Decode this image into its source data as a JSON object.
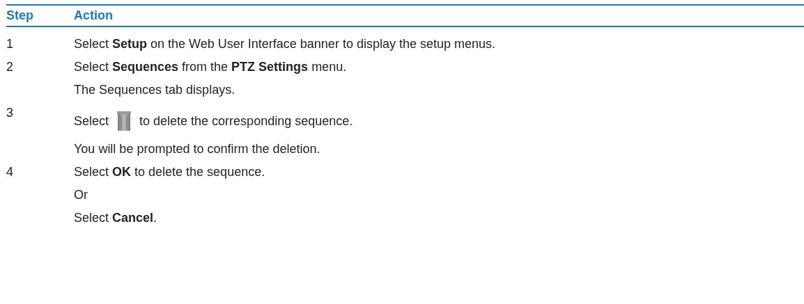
{
  "table": {
    "columns": [
      "Step",
      "Action"
    ],
    "rows": [
      {
        "step": "1",
        "paragraphs": [
          {
            "kind": "text",
            "text": "Select **Setup** on the Web User Interface banner to display the setup menus."
          }
        ]
      },
      {
        "step": "2",
        "paragraphs": [
          {
            "kind": "text",
            "text": "Select **Sequences** from the **PTZ Settings** menu."
          },
          {
            "kind": "text",
            "text": "The Sequences tab displays."
          }
        ]
      },
      {
        "step": "3",
        "paragraphs": [
          {
            "kind": "icon_text",
            "before": "Select",
            "after": "to delete the corresponding sequence."
          },
          {
            "kind": "text",
            "text": "You will be prompted to confirm the deletion."
          }
        ]
      },
      {
        "step": "4",
        "paragraphs": [
          {
            "kind": "text",
            "text": "Select **OK** to delete the sequence."
          },
          {
            "kind": "text",
            "text": "Or"
          },
          {
            "kind": "text",
            "text": "Select **Cancel**."
          }
        ]
      }
    ]
  }
}
